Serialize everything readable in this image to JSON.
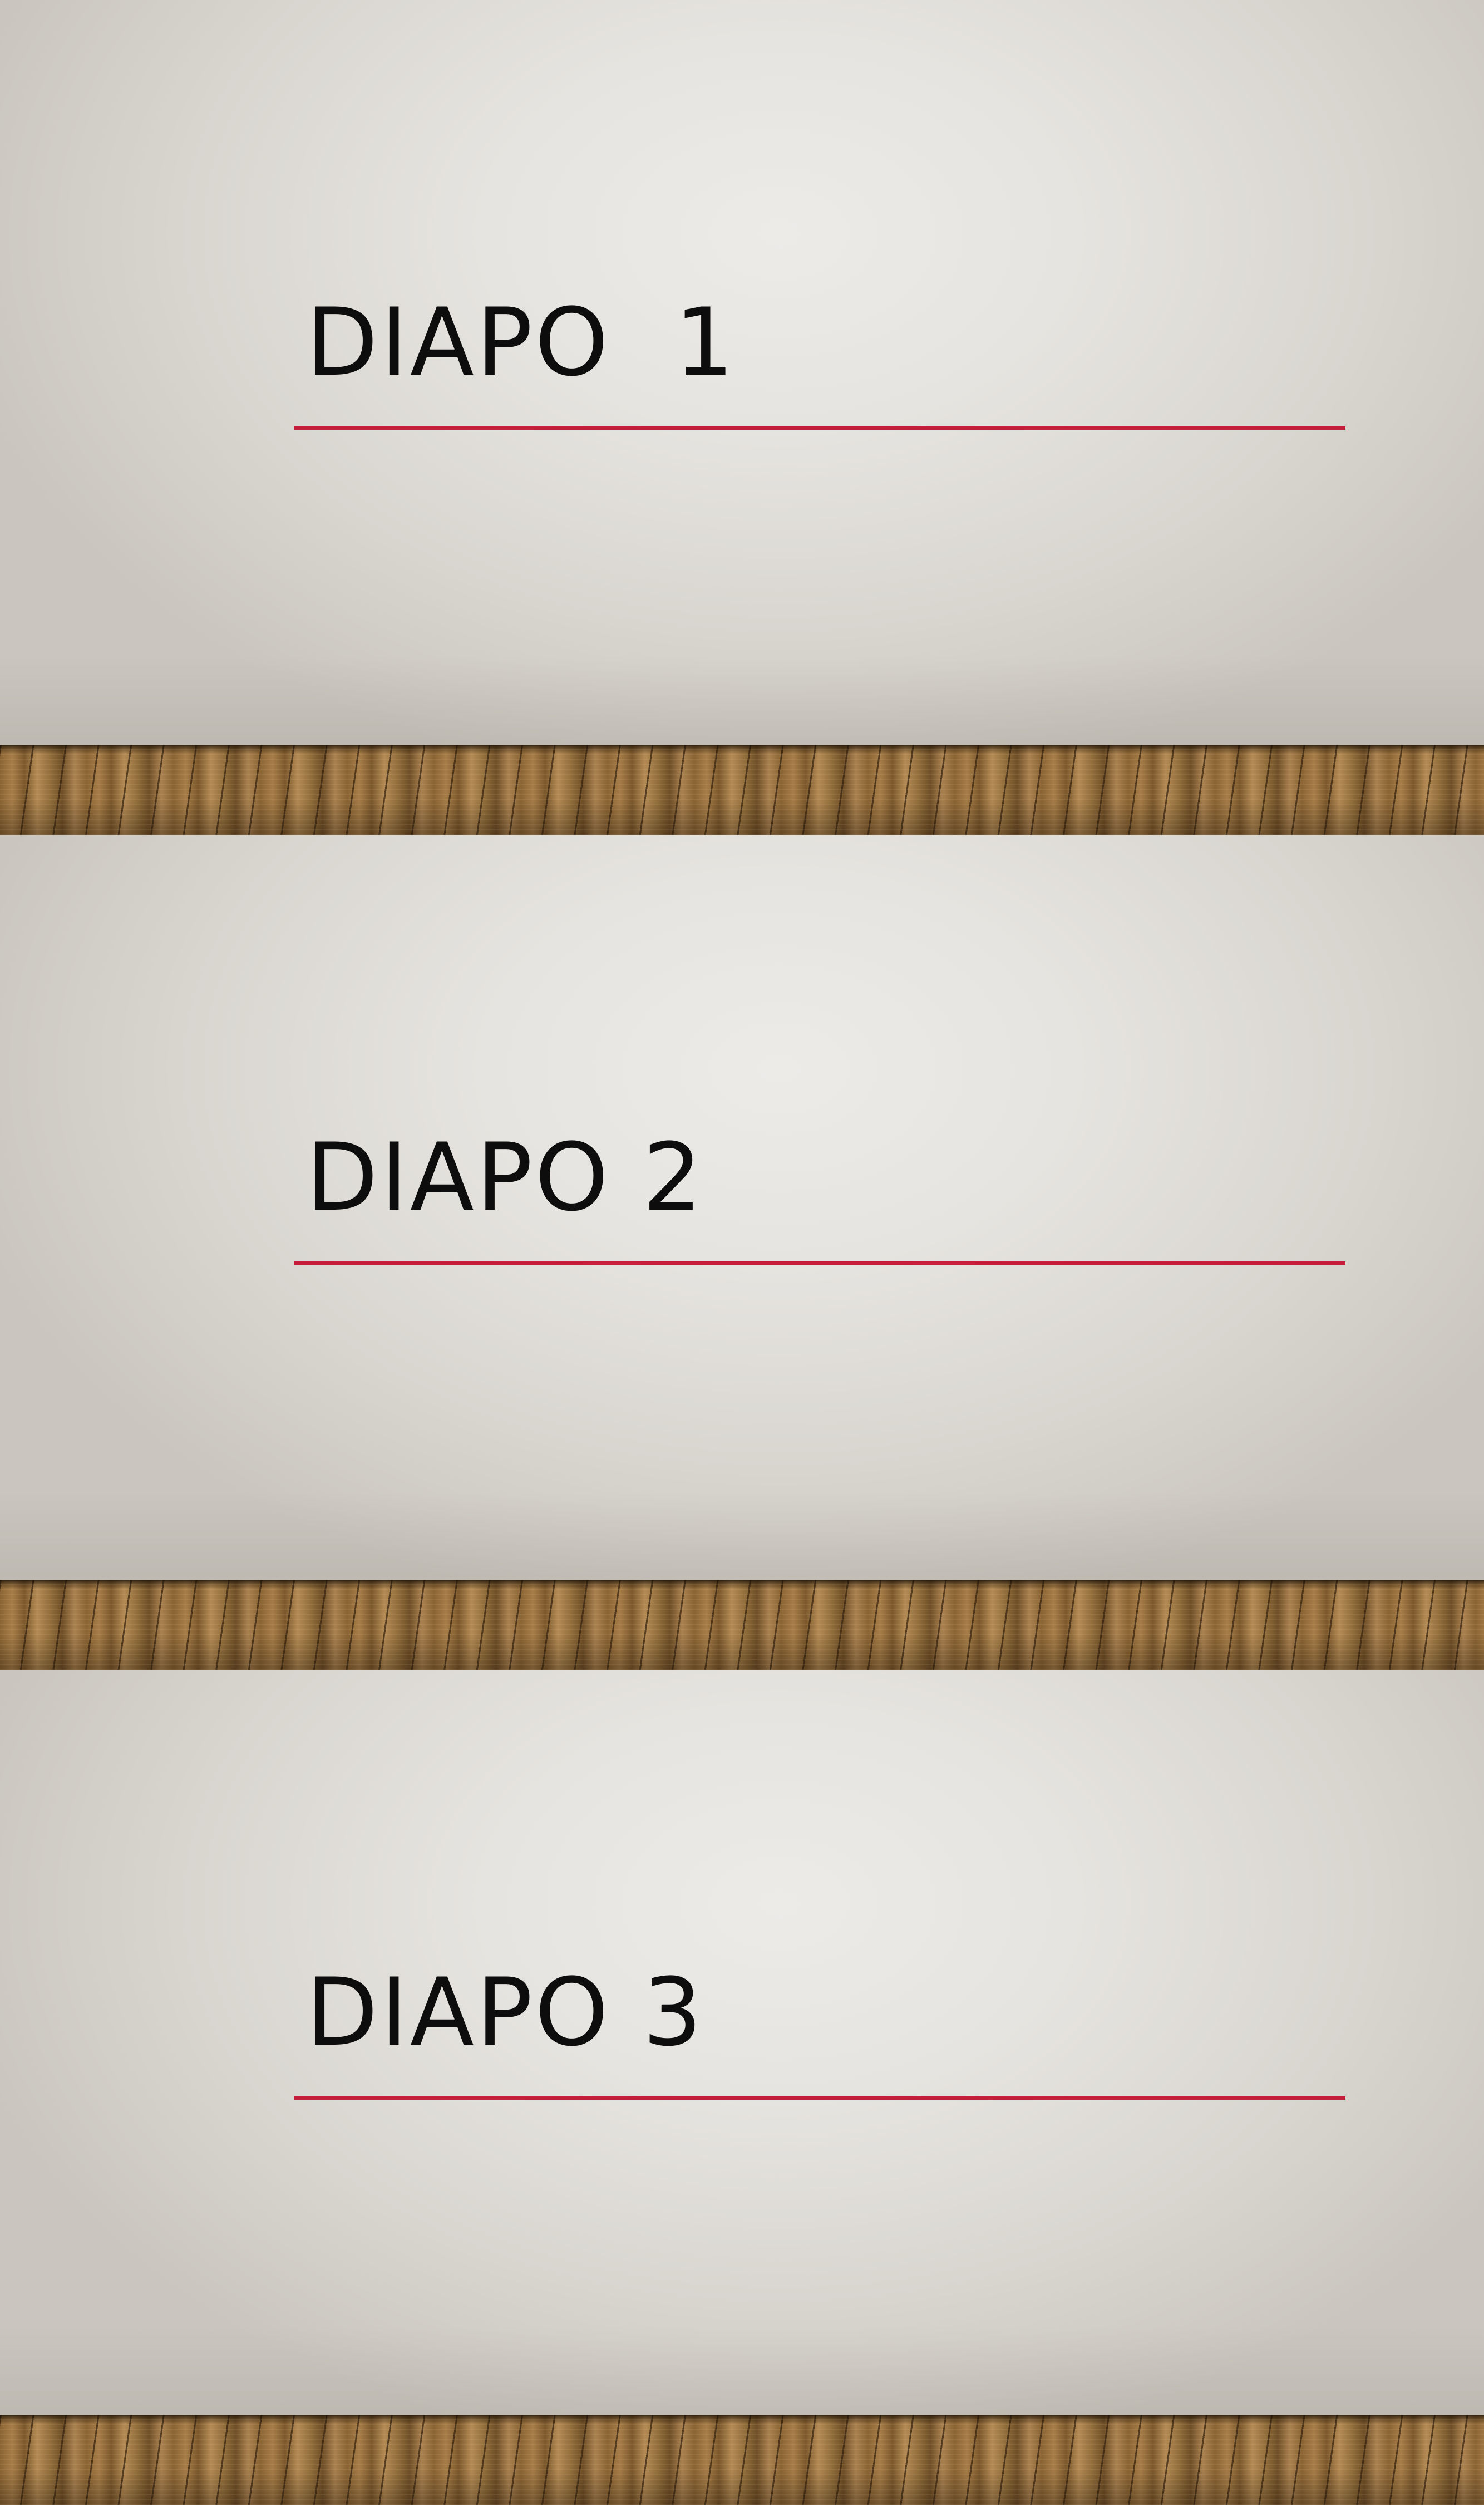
{
  "slides": [
    {
      "title": "DIAPO  1"
    },
    {
      "title": "DIAPO 2"
    },
    {
      "title": "DIAPO 3"
    }
  ],
  "colors": {
    "accent_rule": "#c41e3a",
    "title_text": "#0d0d0d",
    "wall": "#e6e4e0",
    "floor_wood": "#8f6a38"
  }
}
